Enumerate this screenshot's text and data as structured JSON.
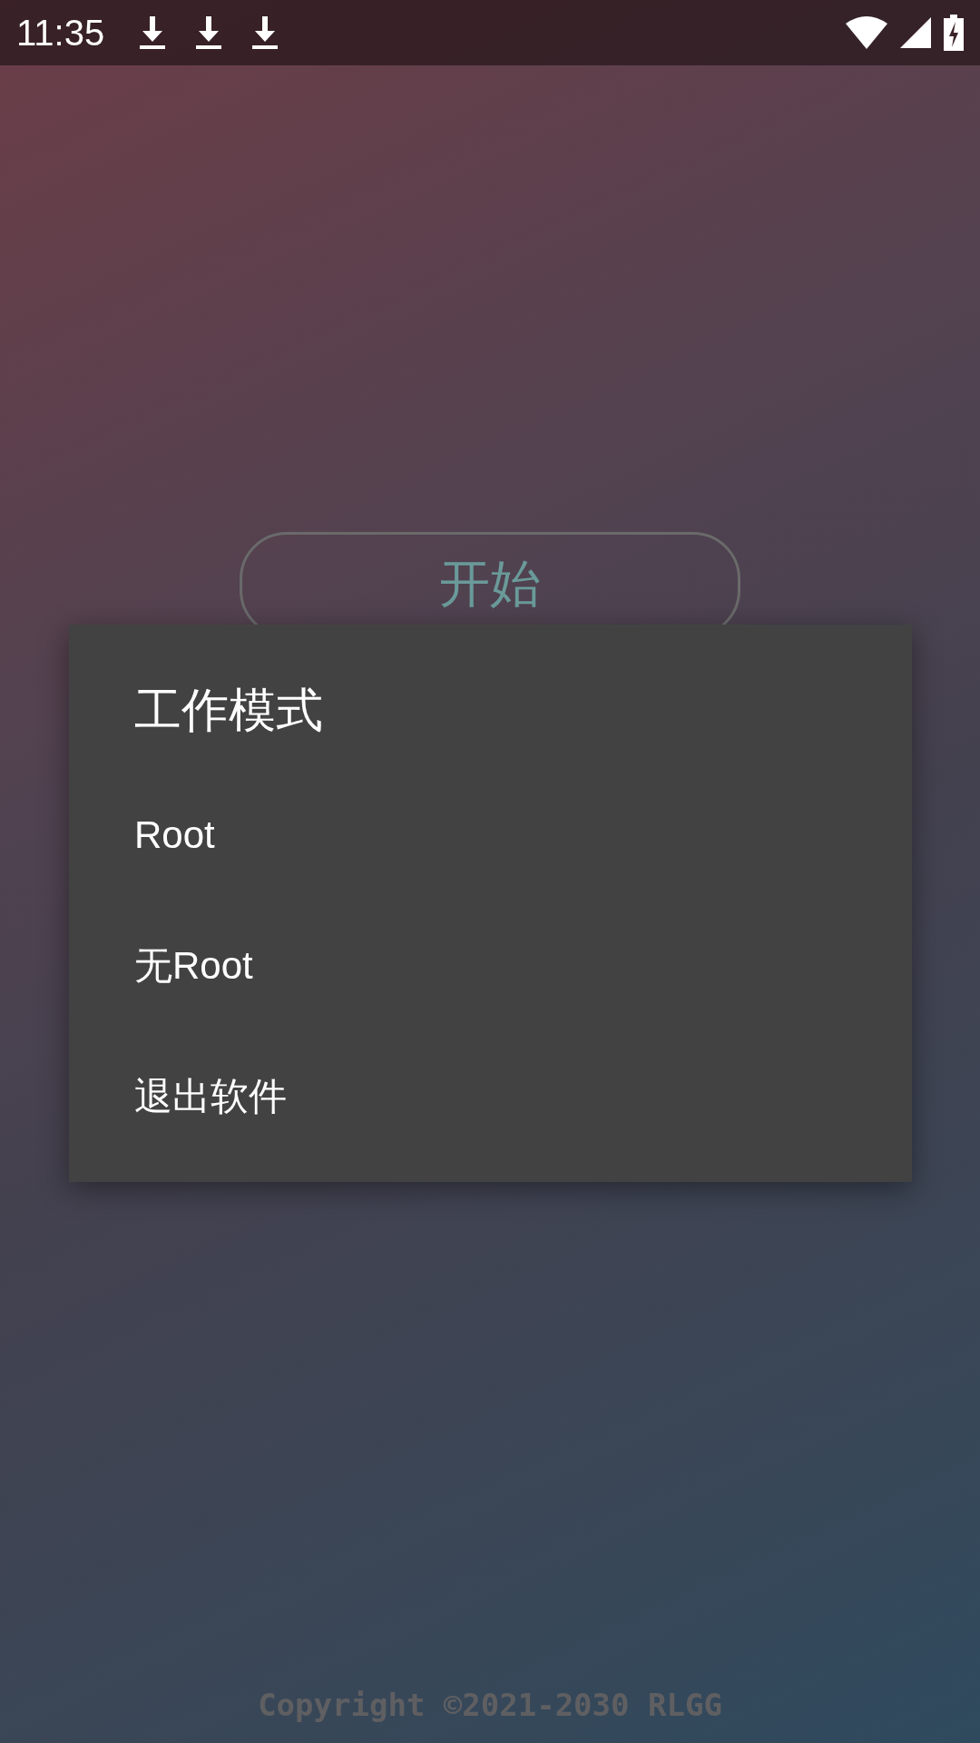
{
  "status_bar": {
    "time": "11:35"
  },
  "start_button": {
    "label": "开始"
  },
  "dialog": {
    "title": "工作模式",
    "items": [
      {
        "label": "Root"
      },
      {
        "label": "无Root"
      },
      {
        "label": "退出软件"
      }
    ]
  },
  "footer": {
    "copyright": "Copyright ©2021-2030 RLGG"
  }
}
